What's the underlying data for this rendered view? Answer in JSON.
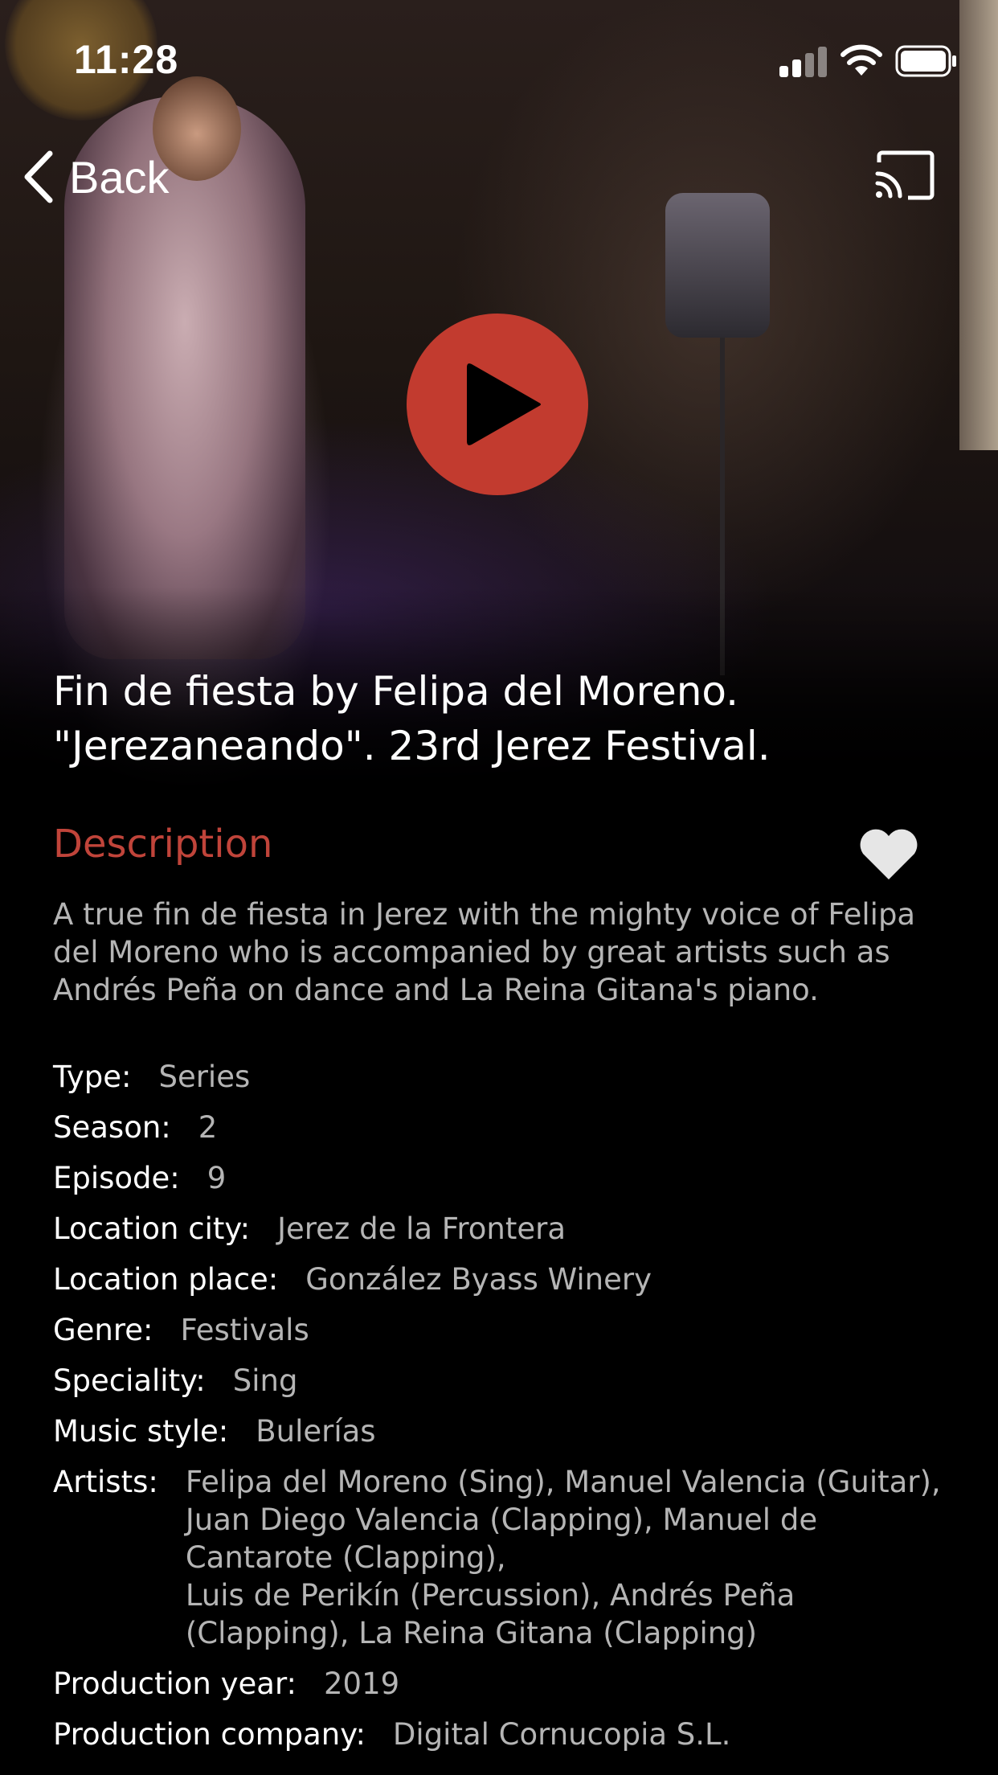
{
  "status_bar": {
    "time": "11:28"
  },
  "nav": {
    "back_label": "Back"
  },
  "video": {
    "title": "Fin de fiesta by Felipa del Moreno.\n\"Jerezaneando\". 23rd Jerez Festival.",
    "accent_color": "#c23b2f"
  },
  "description": {
    "heading": "Description",
    "text": "A true fin de fiesta in Jerez with the mighty voice of Felipa\ndel Moreno who is accompanied by great artists such as\nAndrés Peña on dance and La Reina Gitana's piano."
  },
  "meta": {
    "type": {
      "label": "Type:",
      "value": "Series"
    },
    "season": {
      "label": "Season:",
      "value": "2"
    },
    "episode": {
      "label": "Episode:",
      "value": "9"
    },
    "location_city": {
      "label": "Location city:",
      "value": "Jerez de la Frontera"
    },
    "location_place": {
      "label": "Location place:",
      "value": "González Byass Winery"
    },
    "genre": {
      "label": "Genre:",
      "value": "Festivals"
    },
    "speciality": {
      "label": "Speciality:",
      "value": "Sing"
    },
    "music_style": {
      "label": "Music style:",
      "value": "Bulerías"
    },
    "artists": {
      "label": "Artists:",
      "value": "Felipa del Moreno (Sing), Manuel Valencia (Guitar),\nJuan Diego Valencia (Clapping), Manuel de\nCantarote (Clapping),\nLuis de Perikín (Percussion), Andrés Peña\n(Clapping), La Reina Gitana (Clapping)"
    },
    "production_year": {
      "label": "Production year:",
      "value": "2019"
    },
    "production_company": {
      "label": "Production company:",
      "value": "Digital Cornucopia S.L."
    }
  },
  "icons": {
    "back": "chevron-left-icon",
    "cast": "cast-icon",
    "play": "play-icon",
    "favorite": "heart-icon"
  },
  "colors": {
    "background": "#000000",
    "heading_accent": "#c0443a",
    "label_text": "#ffffff",
    "value_text": "#b5b5b5"
  }
}
